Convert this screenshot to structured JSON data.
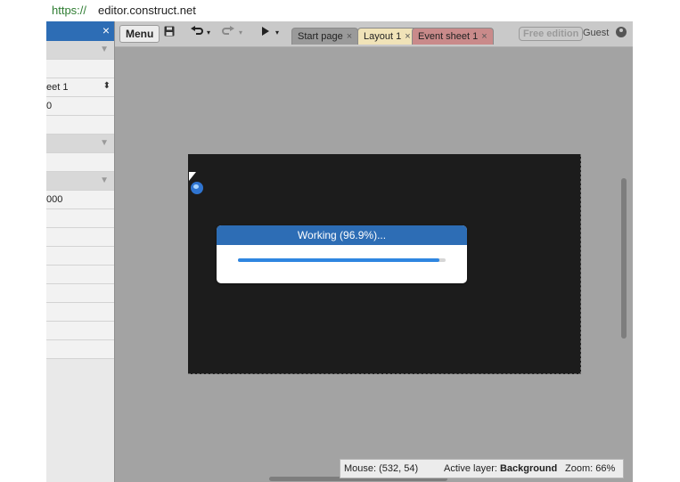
{
  "browser": {
    "url_scheme": "https://",
    "url_rest": "editor.construct.net"
  },
  "toolbar": {
    "menu_label": "Menu",
    "tabs": [
      {
        "label": "Start page",
        "state": "inactive",
        "color": "#9a9a9a"
      },
      {
        "label": "Layout 1",
        "state": "active",
        "color": "#f0e3b8"
      },
      {
        "label": "Event sheet 1",
        "state": "inactive",
        "color": "#c98a8a"
      }
    ],
    "tab_close": "×",
    "free_edition_label": "Free edition",
    "guest_label": "Guest"
  },
  "properties": {
    "close_glyph": "×",
    "rows": [
      {
        "kind": "section",
        "text": ""
      },
      {
        "kind": "row",
        "text": ""
      },
      {
        "kind": "row",
        "text": "eet 1"
      },
      {
        "kind": "row",
        "text": "0"
      },
      {
        "kind": "row",
        "text": ""
      },
      {
        "kind": "section",
        "text": ""
      },
      {
        "kind": "row",
        "text": ""
      },
      {
        "kind": "section",
        "text": ""
      },
      {
        "kind": "row",
        "text": "000"
      },
      {
        "kind": "row",
        "text": ""
      },
      {
        "kind": "row",
        "text": ""
      },
      {
        "kind": "row",
        "text": ""
      },
      {
        "kind": "row",
        "text": ""
      },
      {
        "kind": "row",
        "text": ""
      },
      {
        "kind": "row",
        "text": ""
      },
      {
        "kind": "row",
        "text": ""
      },
      {
        "kind": "row",
        "text": ""
      }
    ]
  },
  "dialog": {
    "title": "Working (96.9%)...",
    "progress": 0.969
  },
  "status": {
    "mouse_label": "Mouse:",
    "mouse_value": "(532, 54)",
    "layer_label": "Active layer:",
    "layer_value": "Background",
    "zoom_label": "Zoom:",
    "zoom_value": "66%"
  },
  "colors": {
    "accent": "#2d6db5",
    "progress": "#2f86e0",
    "canvas": "#1c1c1c"
  },
  "icons": [
    "save-icon",
    "undo-icon",
    "redo-icon",
    "play-icon",
    "user-icon",
    "globe-icon",
    "cursor-icon"
  ]
}
